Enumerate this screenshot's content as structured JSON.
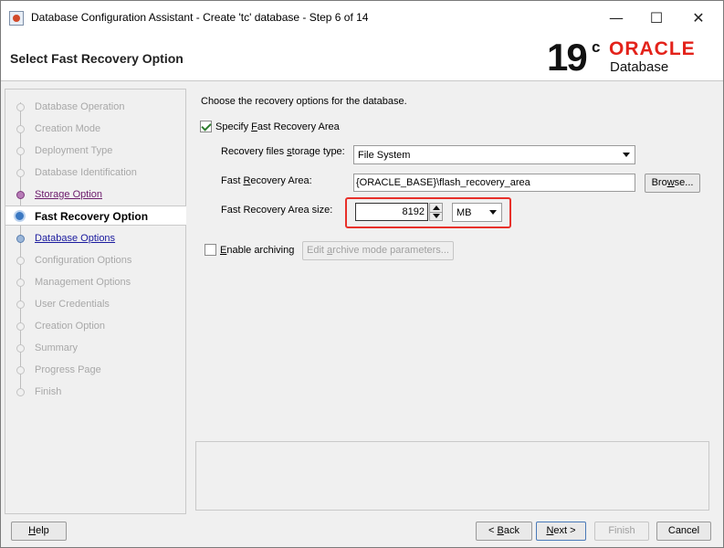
{
  "window": {
    "title": "Database Configuration Assistant - Create 'tc' database - Step 6 of 14",
    "minimize": "—",
    "maximize": "☐",
    "close": "✕"
  },
  "header": {
    "page_title": "Select Fast Recovery Option",
    "logo_version": "19",
    "logo_version_sup": "c",
    "logo_brand": "ORACLE",
    "logo_product": "Database"
  },
  "nav": {
    "items": [
      {
        "label": "Database Operation",
        "state": "disabled"
      },
      {
        "label": "Creation Mode",
        "state": "disabled"
      },
      {
        "label": "Deployment Type",
        "state": "disabled"
      },
      {
        "label": "Database Identification",
        "state": "disabled"
      },
      {
        "label": "Storage Option",
        "state": "visited"
      },
      {
        "label": "Fast Recovery Option",
        "state": "active"
      },
      {
        "label": "Database Options",
        "state": "link"
      },
      {
        "label": "Configuration Options",
        "state": "disabled"
      },
      {
        "label": "Management Options",
        "state": "disabled"
      },
      {
        "label": "User Credentials",
        "state": "disabled"
      },
      {
        "label": "Creation Option",
        "state": "disabled"
      },
      {
        "label": "Summary",
        "state": "disabled"
      },
      {
        "label": "Progress Page",
        "state": "disabled"
      },
      {
        "label": "Finish",
        "state": "disabled"
      }
    ]
  },
  "content": {
    "intro": "Choose the recovery options for the database.",
    "specify_fra": {
      "pre": "Specify ",
      "mnemonic": "F",
      "post": "ast Recovery Area",
      "checked": true
    },
    "storage_type": {
      "label_pre": "Recovery files ",
      "label_mnemonic": "s",
      "label_post": "torage type:",
      "value": "File System"
    },
    "fra_location": {
      "label_pre": "Fast ",
      "label_mnemonic": "R",
      "label_post": "ecovery Area:",
      "value": "{ORACLE_BASE}\\flash_recovery_area"
    },
    "browse": {
      "pre": "Bro",
      "mnemonic": "w",
      "post": "se..."
    },
    "fra_size": {
      "label": "Fast Recovery Area size:",
      "value": "8192",
      "unit": "MB"
    },
    "enable_archiving": {
      "mnemonic": "E",
      "post": "nable archiving",
      "checked": false
    },
    "edit_archive": {
      "pre": "Edit ",
      "mnemonic": "a",
      "post": "rchive mode parameters..."
    }
  },
  "footer": {
    "help": {
      "mnemonic": "H",
      "post": "elp"
    },
    "back": {
      "pre": "< ",
      "mnemonic": "B",
      "post": "ack"
    },
    "next": {
      "mnemonic": "N",
      "post": "ext >"
    },
    "finish": "Finish",
    "cancel": "Cancel"
  },
  "colors": {
    "oracle_red": "#e3221a",
    "highlight": "#e8302a",
    "link": "#1a1a9e",
    "visited": "#6b1a6b",
    "active_step": "#3a78c2"
  }
}
